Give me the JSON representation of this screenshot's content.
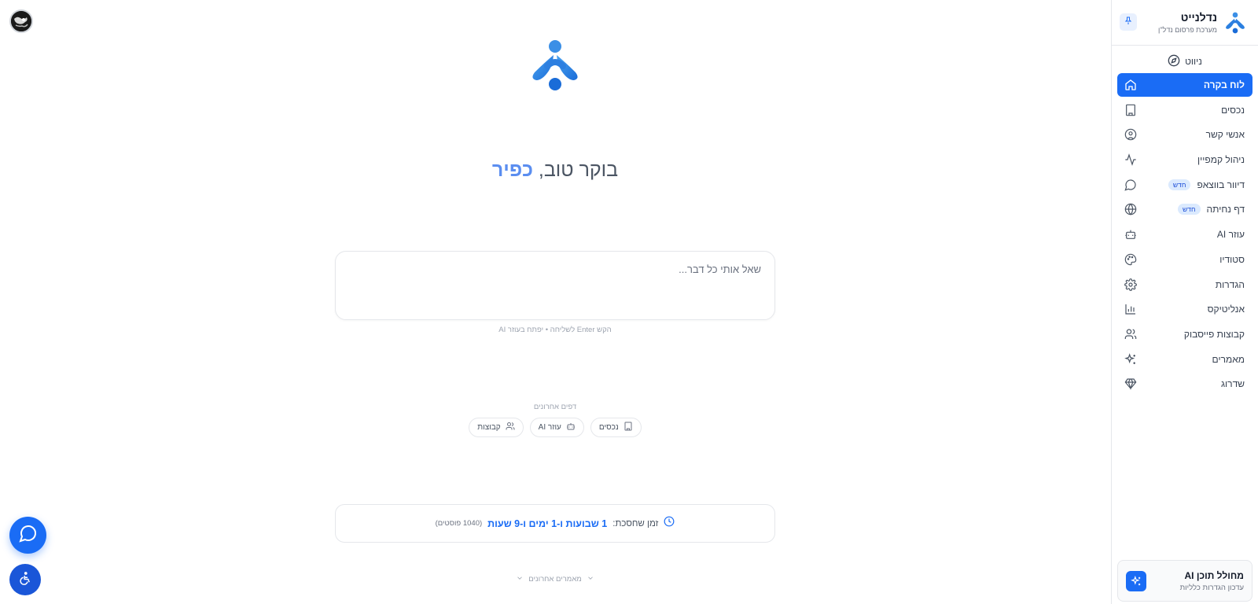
{
  "sidebar": {
    "brand_name": "נדלנייט",
    "brand_subtitle": "מערכת פרסום נדל\"ן",
    "nav_header": "ניווט",
    "items": [
      {
        "label": "לוח בקרה",
        "icon": "home-icon",
        "active": true,
        "badge": ""
      },
      {
        "label": "נכסים",
        "icon": "building-icon",
        "active": false,
        "badge": ""
      },
      {
        "label": "אנשי קשר",
        "icon": "user-circle-icon",
        "active": false,
        "badge": ""
      },
      {
        "label": "ניהול קמפיין",
        "icon": "activity-icon",
        "active": false,
        "badge": ""
      },
      {
        "label": "דיוור בווצאפ",
        "icon": "message-circle-icon",
        "active": false,
        "badge": "חדש"
      },
      {
        "label": "דף נחיתה",
        "icon": "globe-icon",
        "active": false,
        "badge": "חדש"
      },
      {
        "label": "עוזר AI",
        "icon": "bot-icon",
        "active": false,
        "badge": ""
      },
      {
        "label": "סטודיו",
        "icon": "palette-icon",
        "active": false,
        "badge": ""
      },
      {
        "label": "הגדרות",
        "icon": "gear-icon",
        "active": false,
        "badge": ""
      },
      {
        "label": "אנליטיקס",
        "icon": "bar-chart-icon",
        "active": false,
        "badge": ""
      },
      {
        "label": "קבוצות פייסבוק",
        "icon": "users-icon",
        "active": false,
        "badge": ""
      },
      {
        "label": "מאמרים",
        "icon": "sparkles-icon",
        "active": false,
        "badge": ""
      },
      {
        "label": "שדרוג",
        "icon": "gem-icon",
        "active": false,
        "badge": ""
      }
    ],
    "promo": {
      "title": "מחולל תוכן AI",
      "subtitle": "עדכון הגדרות כלליות"
    }
  },
  "main": {
    "greeting_prefix": "בוקר טוב,",
    "greeting_name": "כפיר",
    "ask_placeholder": "שאל אותי כל דבר...",
    "ask_hint": "הקש Enter לשליחה • יפתח בעוזר AI",
    "recent_title": "דפים אחרונים",
    "recent_chips": [
      {
        "label": "נכסים",
        "icon": "building-icon"
      },
      {
        "label": "עוזר AI",
        "icon": "bot-icon"
      },
      {
        "label": "קבוצות",
        "icon": "users-icon"
      }
    ],
    "time_saved_label": "זמן שחסכת:",
    "time_saved_value": "1 שבועות ו-1 ימים ו-9 שעות",
    "time_saved_count": "(1040 פוסטים)",
    "recent_articles_label": "מאמרים אחרונים"
  },
  "colors": {
    "accent": "#1a6cf5",
    "name_highlight": "#5b8ef0"
  }
}
